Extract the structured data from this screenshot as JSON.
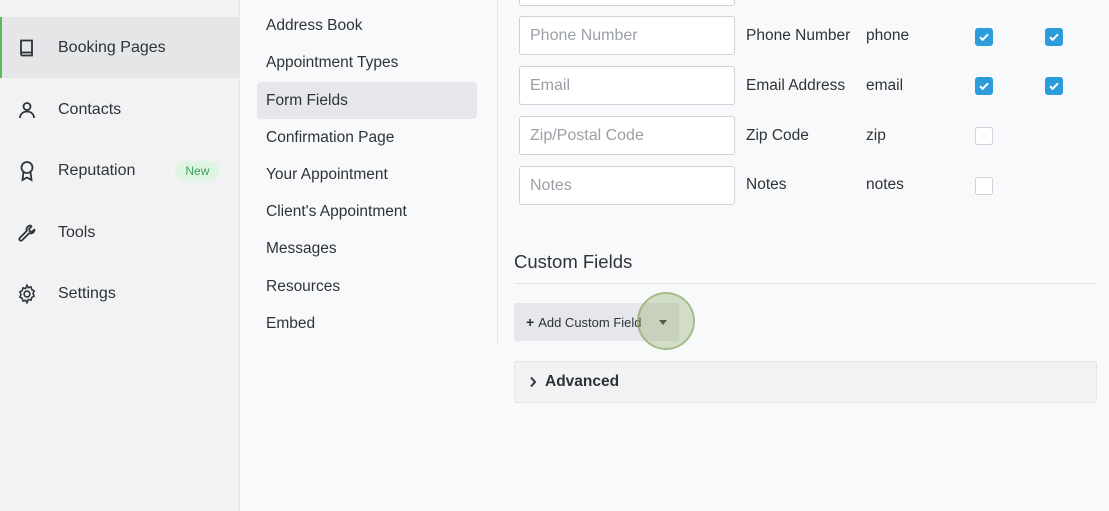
{
  "sidebar": {
    "items": [
      {
        "label": "Booking Pages",
        "icon": "book-icon",
        "active": true
      },
      {
        "label": "Contacts",
        "icon": "person-icon"
      },
      {
        "label": "Reputation",
        "icon": "award-icon",
        "badge": "New"
      },
      {
        "label": "Tools",
        "icon": "wrench-icon"
      },
      {
        "label": "Settings",
        "icon": "gear-icon"
      }
    ]
  },
  "subnav": {
    "items": [
      {
        "label": "Address Book"
      },
      {
        "label": "Appointment Types"
      },
      {
        "label": "Form Fields",
        "active": true
      },
      {
        "label": "Confirmation Page"
      },
      {
        "label": "Your Appointment"
      },
      {
        "label": "Client's Appointment"
      },
      {
        "label": "Messages"
      },
      {
        "label": "Resources"
      },
      {
        "label": "Embed"
      }
    ]
  },
  "form_fields": {
    "rows": [
      {
        "placeholder": "Phone Number",
        "label": "Phone Number",
        "key": "phone",
        "col1_checked": true,
        "col2_checked": true
      },
      {
        "placeholder": "Email",
        "label": "Email Address",
        "key": "email",
        "col1_checked": true,
        "col2_checked": true
      },
      {
        "placeholder": "Zip/Postal Code",
        "label": "Zip Code",
        "key": "zip",
        "col1_checked": false
      },
      {
        "placeholder": "Notes",
        "label": "Notes",
        "key": "notes",
        "col1_checked": false
      }
    ]
  },
  "custom_fields": {
    "title": "Custom Fields",
    "add_button_label": "Add Custom Field"
  },
  "advanced": {
    "label": "Advanced"
  },
  "colors": {
    "accent_green": "#5cb85c",
    "checkbox_blue": "#2d9cdb",
    "badge_bg": "#dff4e3",
    "badge_text": "#3aa35a"
  }
}
